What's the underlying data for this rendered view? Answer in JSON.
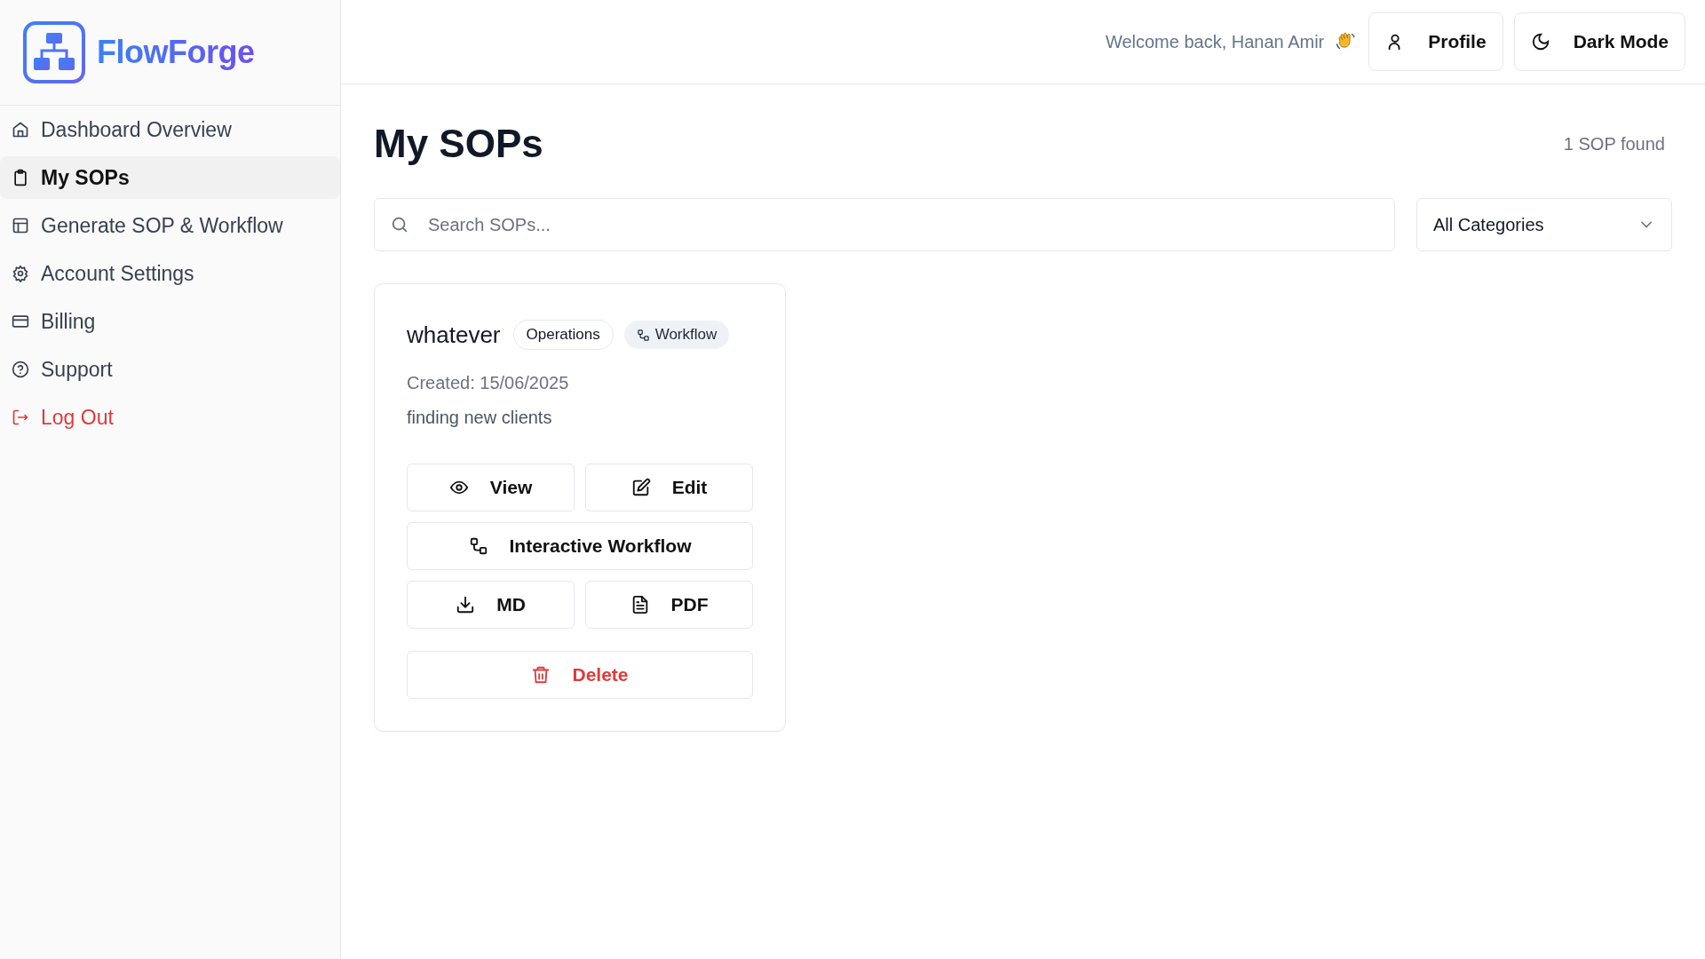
{
  "brand": {
    "name": "FlowForge"
  },
  "sidebar": {
    "items": [
      {
        "label": "Dashboard Overview",
        "selected": false,
        "kind": "nav"
      },
      {
        "label": "My SOPs",
        "selected": true,
        "kind": "nav"
      },
      {
        "label": "Generate SOP & Workflow",
        "selected": false,
        "kind": "nav"
      },
      {
        "label": "Account Settings",
        "selected": false,
        "kind": "nav"
      },
      {
        "label": "Billing",
        "selected": false,
        "kind": "nav"
      },
      {
        "label": "Support",
        "selected": false,
        "kind": "nav"
      },
      {
        "label": "Log Out",
        "selected": false,
        "kind": "logout"
      }
    ]
  },
  "header": {
    "welcome": "Welcome back, Hanan Amir",
    "buttons": [
      "Profile",
      "Dark Mode"
    ]
  },
  "page": {
    "title": "My SOPs",
    "count": "1 SOP found",
    "search": {
      "placeholder": "Search SOPs..."
    },
    "category_filter": {
      "value": "All Categories"
    }
  },
  "sops": [
    {
      "title": "whatever",
      "tags": [
        {
          "label": "Operations",
          "kind": "category"
        },
        {
          "label": "Workflow",
          "kind": "type"
        }
      ],
      "created": "Created: 15/06/2025",
      "description": "finding new clients",
      "actions": [
        {
          "label": "View",
          "kind": "half"
        },
        {
          "label": "Edit",
          "kind": "half"
        },
        {
          "label": "Interactive Workflow",
          "kind": "full"
        },
        {
          "label": "MD",
          "kind": "half"
        },
        {
          "label": "PDF",
          "kind": "half"
        },
        {
          "label": "Delete",
          "kind": "danger"
        }
      ]
    }
  ]
}
